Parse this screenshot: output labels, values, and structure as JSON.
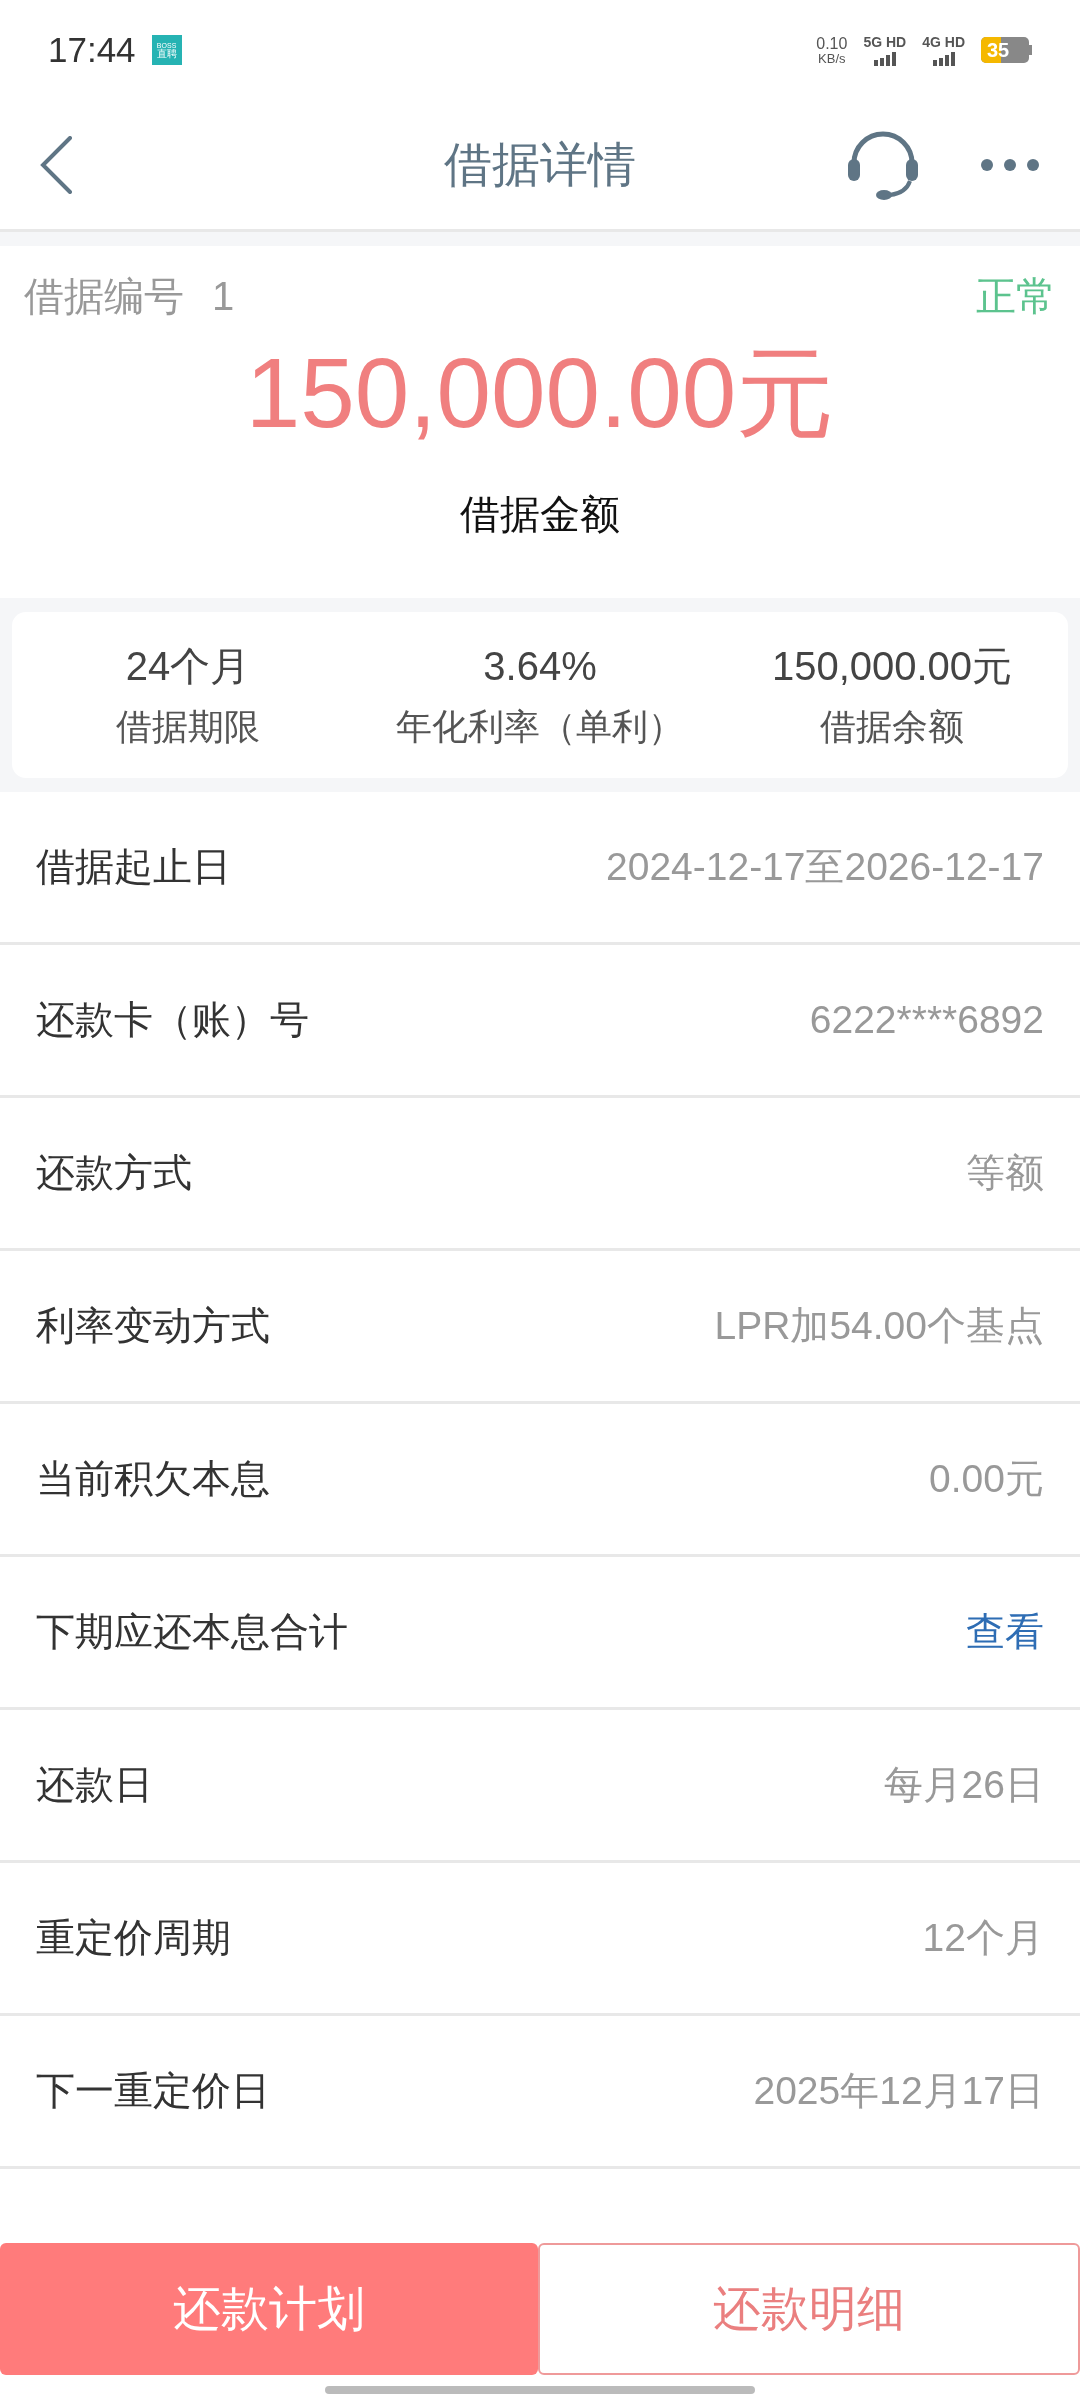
{
  "status_bar": {
    "time": "17:44",
    "app_badge": [
      "BOSS",
      "直聘"
    ],
    "speed": [
      "0.10",
      "KB/s"
    ],
    "networks": [
      "5G HD",
      "4G HD"
    ],
    "battery": "35"
  },
  "header": {
    "title": "借据详情"
  },
  "summary": {
    "number_label": "借据编号",
    "number": "1",
    "status": "正常",
    "amount": "150,000.00元",
    "amount_label": "借据金额"
  },
  "stats": [
    {
      "value": "24个月",
      "label": "借据期限"
    },
    {
      "value": "3.64%",
      "label": "年化利率（单利）"
    },
    {
      "value": "150,000.00元",
      "label": "借据余额"
    }
  ],
  "rows": [
    {
      "label": "借据起止日",
      "value": "2024-12-17至2026-12-17",
      "kind": "text"
    },
    {
      "label": "还款卡（账）号",
      "value": "6222****6892",
      "kind": "text"
    },
    {
      "label": "还款方式",
      "value": "等额",
      "kind": "text"
    },
    {
      "label": "利率变动方式",
      "value": "LPR加54.00个基点",
      "kind": "text"
    },
    {
      "label": "当前积欠本息",
      "value": "0.00元",
      "kind": "text"
    },
    {
      "label": "下期应还本息合计",
      "value": "查看",
      "kind": "link"
    },
    {
      "label": "还款日",
      "value": "每月26日",
      "kind": "text"
    },
    {
      "label": "重定价周期",
      "value": "12个月",
      "kind": "text"
    },
    {
      "label": "下一重定价日",
      "value": "2025年12月17日",
      "kind": "text"
    }
  ],
  "buttons": [
    {
      "label": "还款计划",
      "kind": "primary"
    },
    {
      "label": "还款明细",
      "kind": "outline"
    }
  ]
}
